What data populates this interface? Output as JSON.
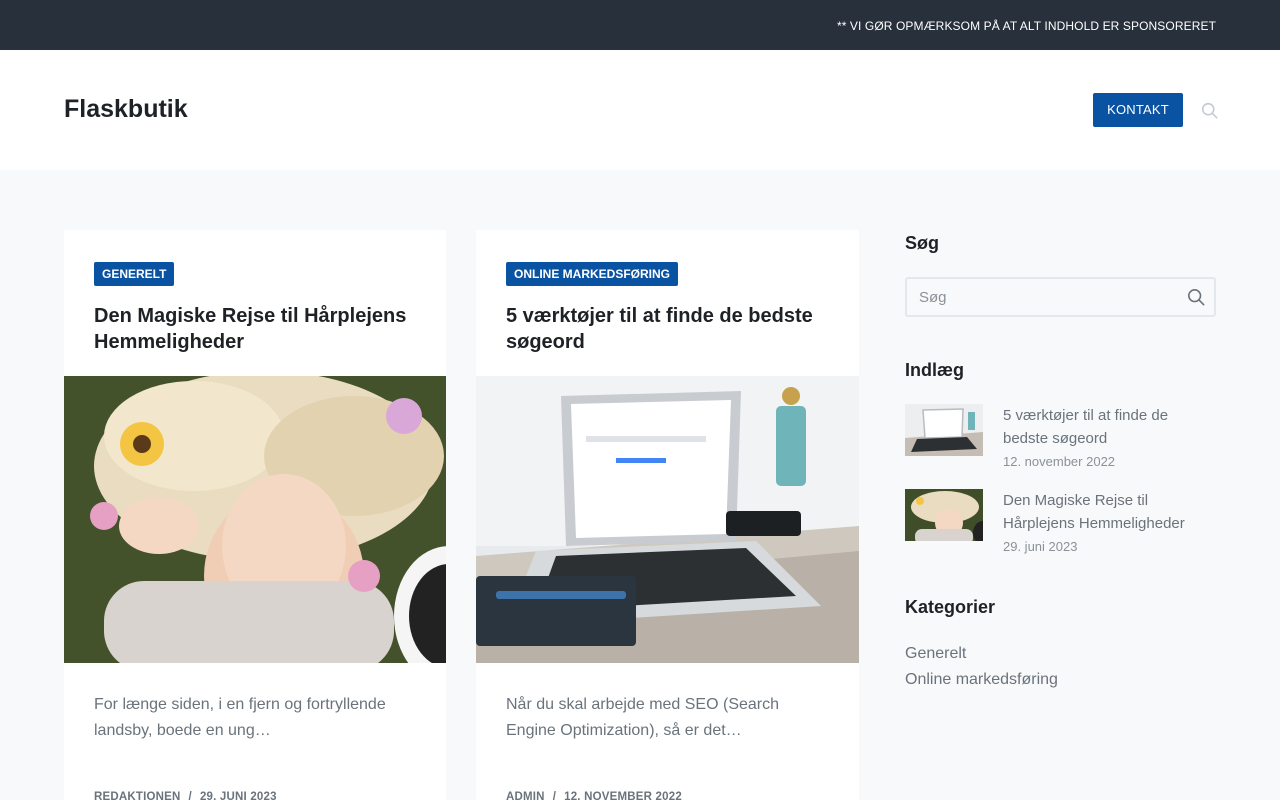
{
  "topbar": {
    "notice": "** VI GØR OPMÆRKSOM PÅ AT ALT INDHOLD ER SPONSORERET"
  },
  "header": {
    "site_title": "Flaskbutik",
    "contact_label": "KONTAKT",
    "search_icon": "search-icon"
  },
  "posts": [
    {
      "category": "GENERELT",
      "title": "Den Magiske Rejse til Hårplejens Hemmeligheder",
      "excerpt": "For længe siden, i en fjern og fortryllende landsby, boede en ung…",
      "author": "REDAKTIONEN",
      "date": "29. JUNI 2023"
    },
    {
      "category": "ONLINE MARKEDSFØRING",
      "title": "5 værktøjer til at finde de bedste søgeord",
      "excerpt": "Når du skal arbejde med SEO (Search Engine Optimization), så er det…",
      "author": "ADMIN",
      "date": "12. NOVEMBER 2022"
    }
  ],
  "sidebar": {
    "search": {
      "heading": "Søg",
      "placeholder": "Søg"
    },
    "recent": {
      "heading": "Indlæg",
      "items": [
        {
          "title": "5 værktøjer til at finde de bedste søgeord",
          "date": "12. november 2022"
        },
        {
          "title": "Den Magiske Rejse til Hårplejens Hemmeligheder",
          "date": "29. juni 2023"
        }
      ]
    },
    "categories": {
      "heading": "Kategorier",
      "items": [
        "Generelt",
        "Online markedsføring"
      ]
    }
  },
  "colors": {
    "accent": "#0953a2",
    "topbar": "#27303b",
    "page_bg": "#f8f9fa"
  }
}
